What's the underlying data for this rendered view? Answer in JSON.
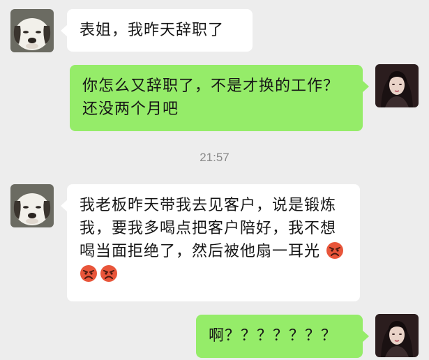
{
  "messages": {
    "m1": {
      "sender": "cousin",
      "text": "表姐，我昨天辞职了"
    },
    "m2": {
      "sender": "me",
      "text": "你怎么又辞职了，不是才换的工作？还没两个月吧"
    },
    "timestamp": "21:57",
    "m3": {
      "sender": "cousin",
      "text": "我老板昨天带我去见客户，说是锻炼我，要我多喝点把客户陪好，我不想喝当面拒绝了，然后被他扇一耳光",
      "emojis": [
        "angry-face-icon",
        "angry-face-icon",
        "angry-face-icon"
      ]
    },
    "m4": {
      "sender": "me",
      "text": "啊？？？？？？？"
    }
  },
  "colors": {
    "background": "#ededed",
    "incoming_bubble": "#ffffff",
    "outgoing_bubble": "#95ec69",
    "timestamp": "#8a8a8a"
  }
}
